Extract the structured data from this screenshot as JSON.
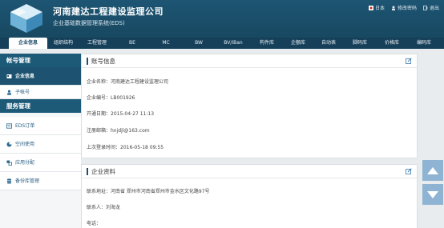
{
  "header": {
    "company": "河南建达工程建设监理公司",
    "system": "企业基础数据管理系统(EDS)",
    "links": [
      "日本",
      "修改密码",
      "退出"
    ]
  },
  "nav": {
    "items": [
      "企业信息",
      "组织结构",
      "工程管理",
      "BE",
      "MC",
      "BW",
      "BV/IBan",
      "构件库",
      "企额库",
      "自动表",
      "脚码库",
      "价格库",
      "编码库"
    ],
    "active": 0
  },
  "sidebar": {
    "account_title": "帐号管理",
    "account_items": [
      "企业信息",
      "子帐号"
    ],
    "service_title": "服务管理",
    "service_items": [
      "EDS订单",
      "空间使用",
      "应用分配",
      "备份库管理"
    ]
  },
  "account_panel": {
    "title": "账号信息",
    "company_name": "企业名称：河南建达工程建设监理公司",
    "company_code": "企业编号：LB001926",
    "open_date": "开通日期：2015-04-27 11:13",
    "email": "注册邮箱：hnjdjl@163.com",
    "last_login": "上次登录时间：2016-05-18 09:55"
  },
  "company_panel": {
    "title": "企业资料",
    "address": "联系地址：河南省 郑州市河南省郑州市金水区文化路97号",
    "contact": "联系人：刘海龙",
    "phone": "电话："
  },
  "colors": {
    "header": "#1b4f6b",
    "nav": "#16405a",
    "sidebar_section": "#1c5a78",
    "active_item": "#1d5370",
    "scroll_button": "#8fb3d2"
  }
}
